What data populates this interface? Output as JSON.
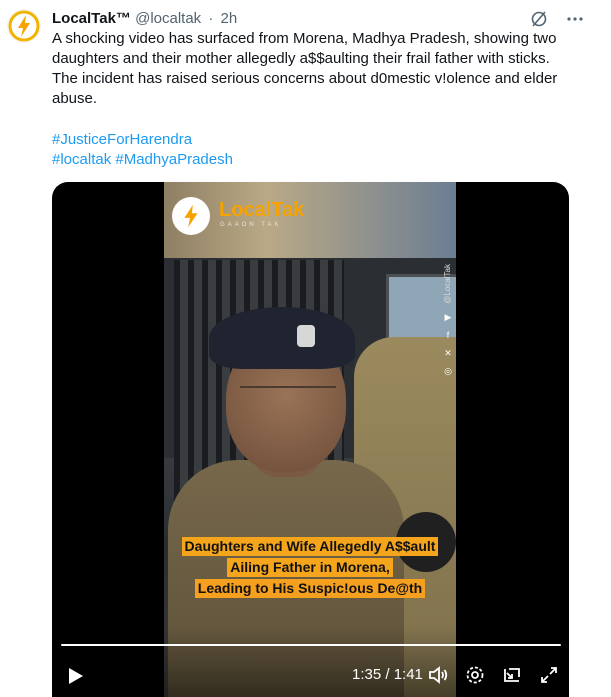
{
  "post": {
    "author_name": "LocalTak™",
    "author_handle": "@localtak",
    "separator": "·",
    "timestamp": "2h",
    "text": "A shocking video has surfaced from Morena, Madhya Pradesh, showing two daughters and their mother allegedly a$$aulting their frail father with sticks. The incident has raised serious concerns about d0mestic v!olence and elder abuse.",
    "hashtags_line1": "#JusticeForHarendra",
    "hashtags_line2": "#localtak #MadhyaPradesh",
    "top_icons": [
      "grok-icon",
      "more-icon"
    ]
  },
  "video": {
    "brand_name": "LocalTak",
    "brand_tagline": "GAAON TAK",
    "side_handle": "@LocalTak",
    "caption_line1": "Daughters and Wife Allegedly A$$ault",
    "caption_line2": "Ailing Father in Morena,",
    "caption_line3": "Leading to His Suspic!ous De@th",
    "time_readout": "1:35 / 1:41",
    "progress_fraction": 0.95,
    "controls": [
      "play-icon",
      "volume-icon",
      "settings-icon",
      "picture-in-picture-icon",
      "fullscreen-icon"
    ]
  },
  "colors": {
    "accent": "#1d9bf0",
    "brand_orange": "#f6a300",
    "caption_bg": "#f4a51c"
  }
}
